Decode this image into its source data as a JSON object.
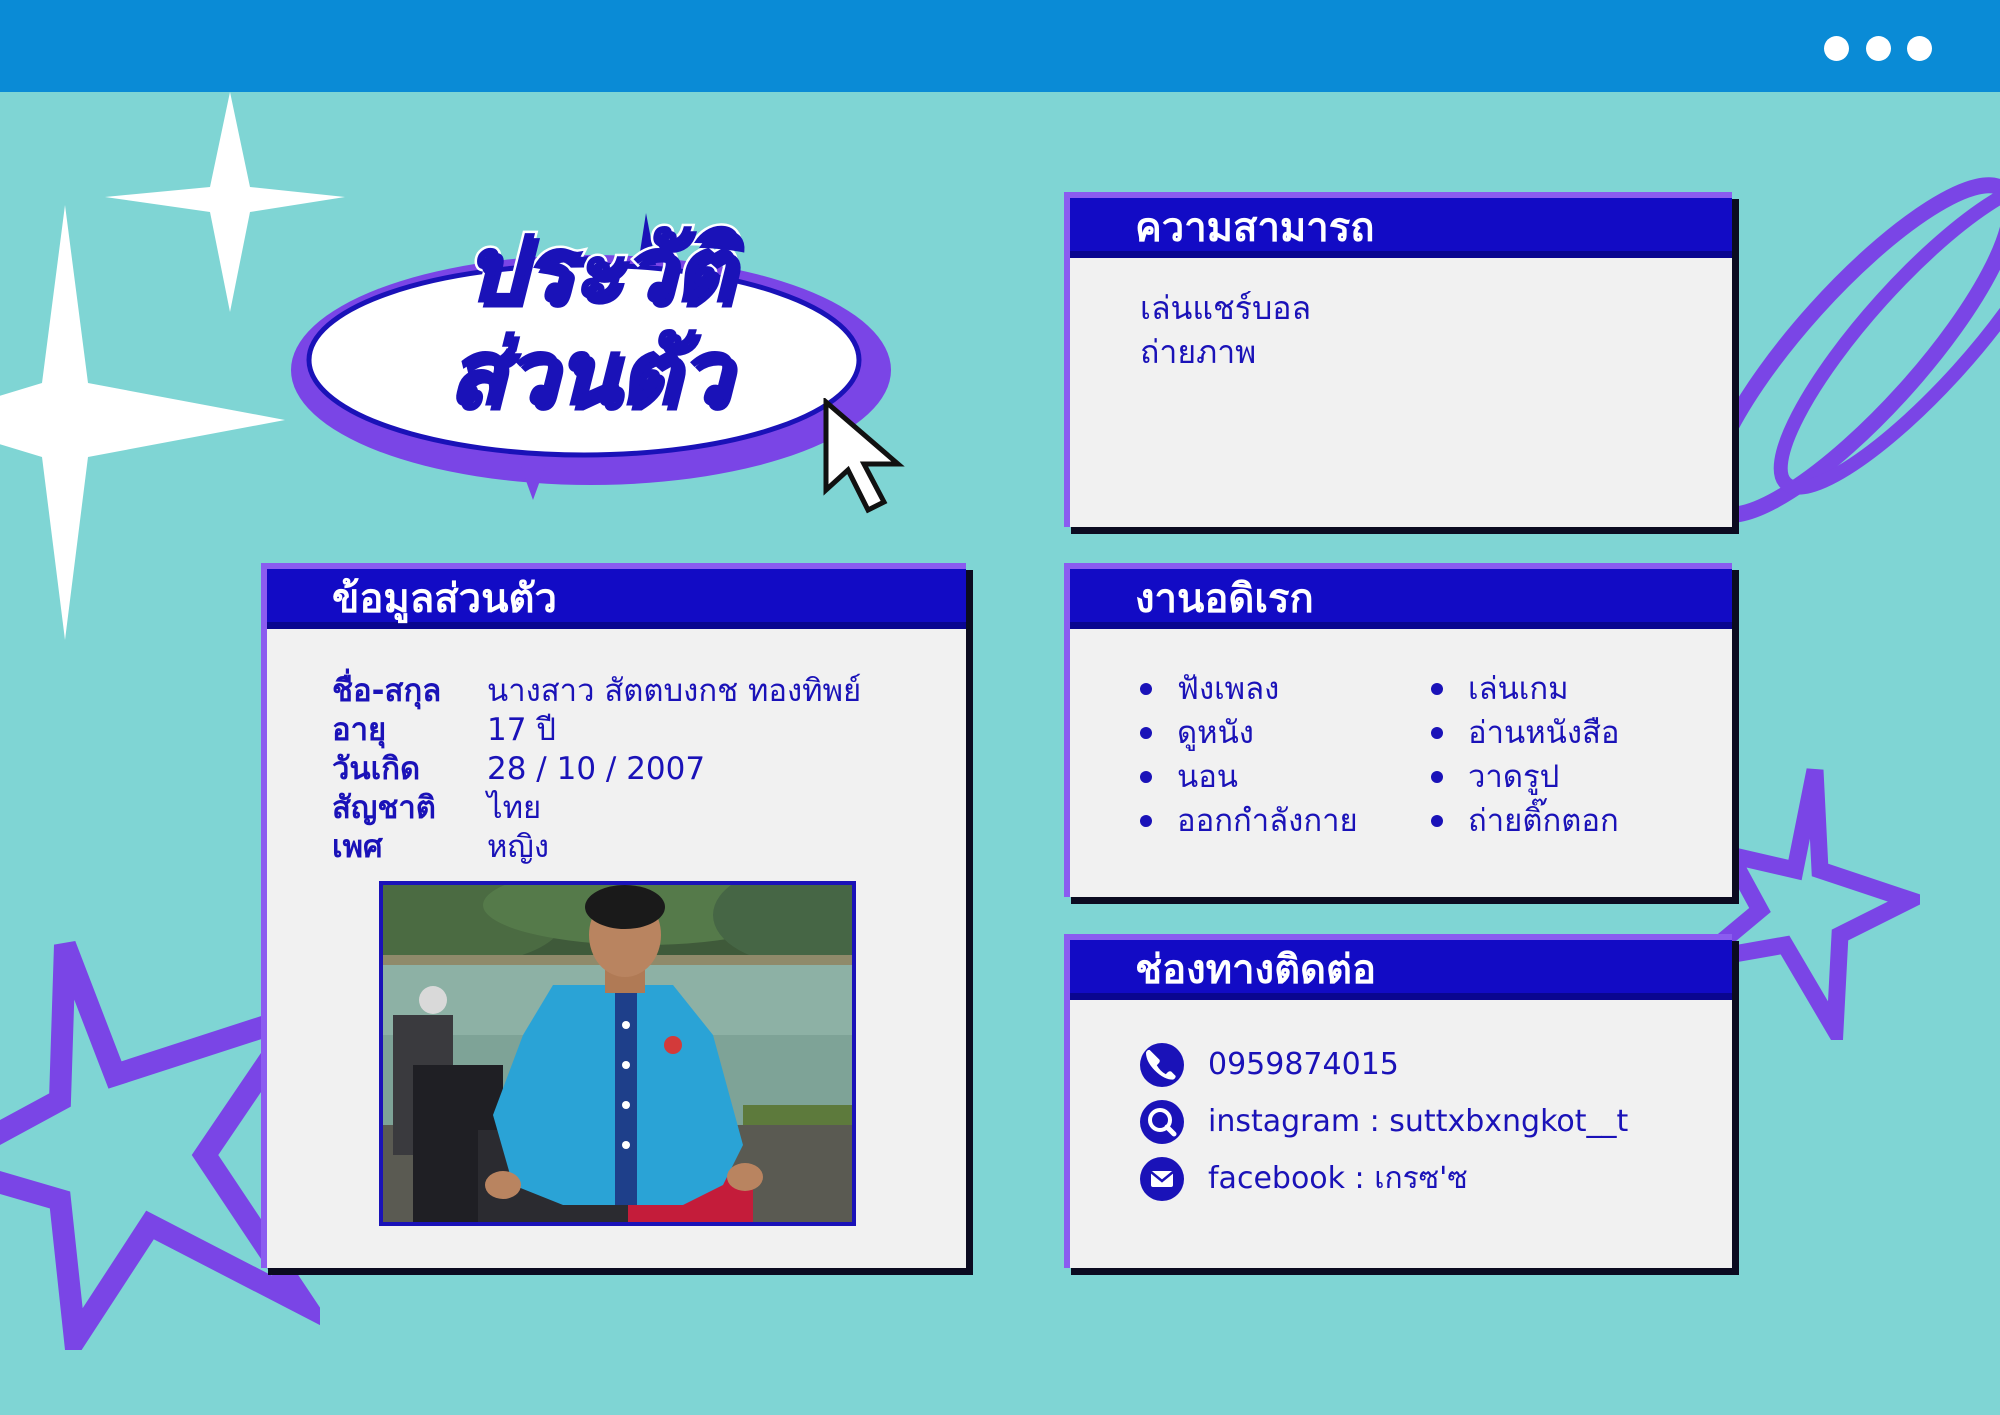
{
  "window": {
    "menu_icon": "more-dots-icon"
  },
  "title": {
    "line1": "ประวัติ",
    "line2": "ส่วนตัว"
  },
  "abilities": {
    "heading": "ความสามารถ",
    "items": [
      "เล่นแชร์บอล",
      "ถ่ายภาพ"
    ]
  },
  "personal": {
    "heading": "ข้อมูลส่วนตัว",
    "rows": [
      {
        "label": "ชื่อ-สกุล",
        "value": "นางสาว สัตตบงกช ทองทิพย์"
      },
      {
        "label": "อายุ",
        "value": "17 ปี"
      },
      {
        "label": "วันเกิด",
        "value": "28 / 10 / 2007"
      },
      {
        "label": "สัญชาติ",
        "value": "ไทย"
      },
      {
        "label": "เพศ",
        "value": "หญิง"
      }
    ]
  },
  "hobbies": {
    "heading": "งานอดิเรก",
    "items": [
      "ฟังเพลง",
      "ดูหนัง",
      "นอน",
      "ออกกำลังกาย",
      "เล่นเกม",
      "อ่านหนังสือ",
      "วาดรูป",
      "ถ่ายติ๊กตอก"
    ]
  },
  "contact": {
    "heading": "ช่องทางติดต่อ",
    "items": [
      {
        "icon": "phone-icon",
        "text": "0959874015"
      },
      {
        "icon": "search-icon",
        "text": "instagram : suttxbxngkot__t"
      },
      {
        "icon": "mail-icon",
        "text": "facebook : เกรซ'ซ"
      }
    ]
  },
  "colors": {
    "background": "#7fd5d4",
    "topbar": "#0a8bd6",
    "header_blue": "#120bc5",
    "accent_purple": "#7a45e6",
    "panel": "#f1f1f1",
    "text_blue": "#1a12b8"
  }
}
